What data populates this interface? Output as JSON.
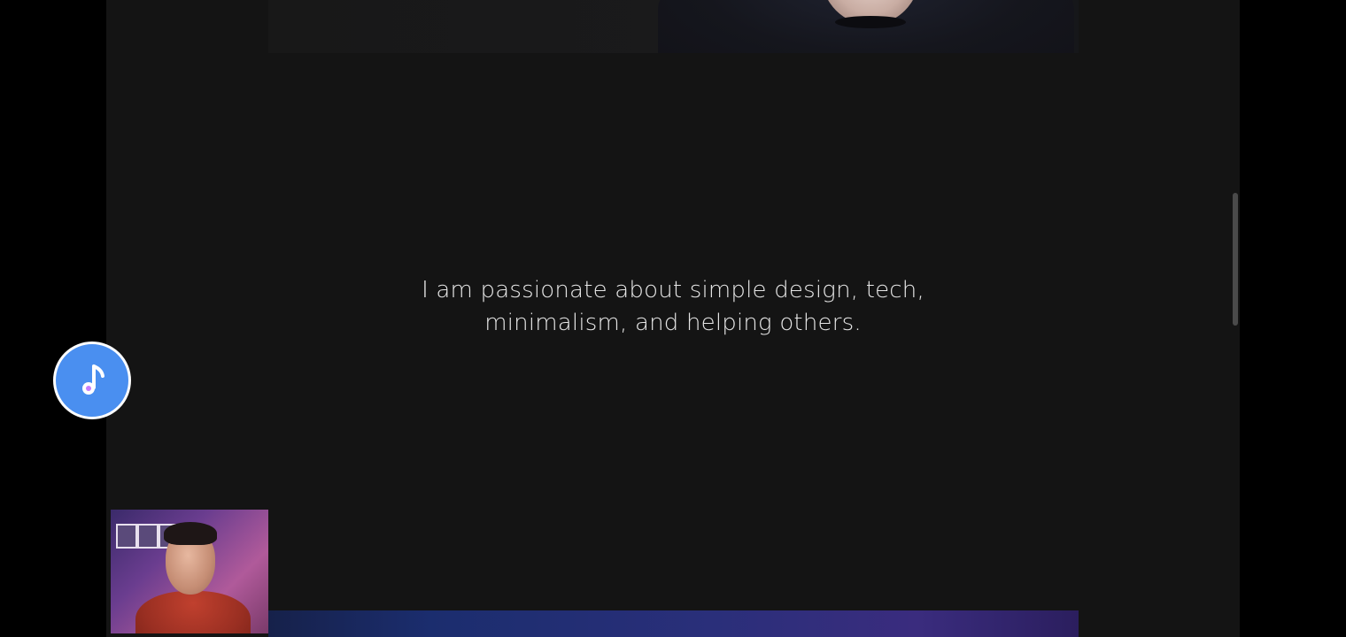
{
  "page": {
    "background_color": "#000000",
    "content_background_color": "#141414"
  },
  "about": {
    "tagline_line1": "I am passionate about simple design, tech,",
    "tagline_line2": "minimalism, and helping others."
  },
  "music_player": {
    "icon": "music-note-icon",
    "accent_color": "#4a8ff0"
  },
  "webcam_overlay": {
    "icon": "webcam-feed"
  }
}
